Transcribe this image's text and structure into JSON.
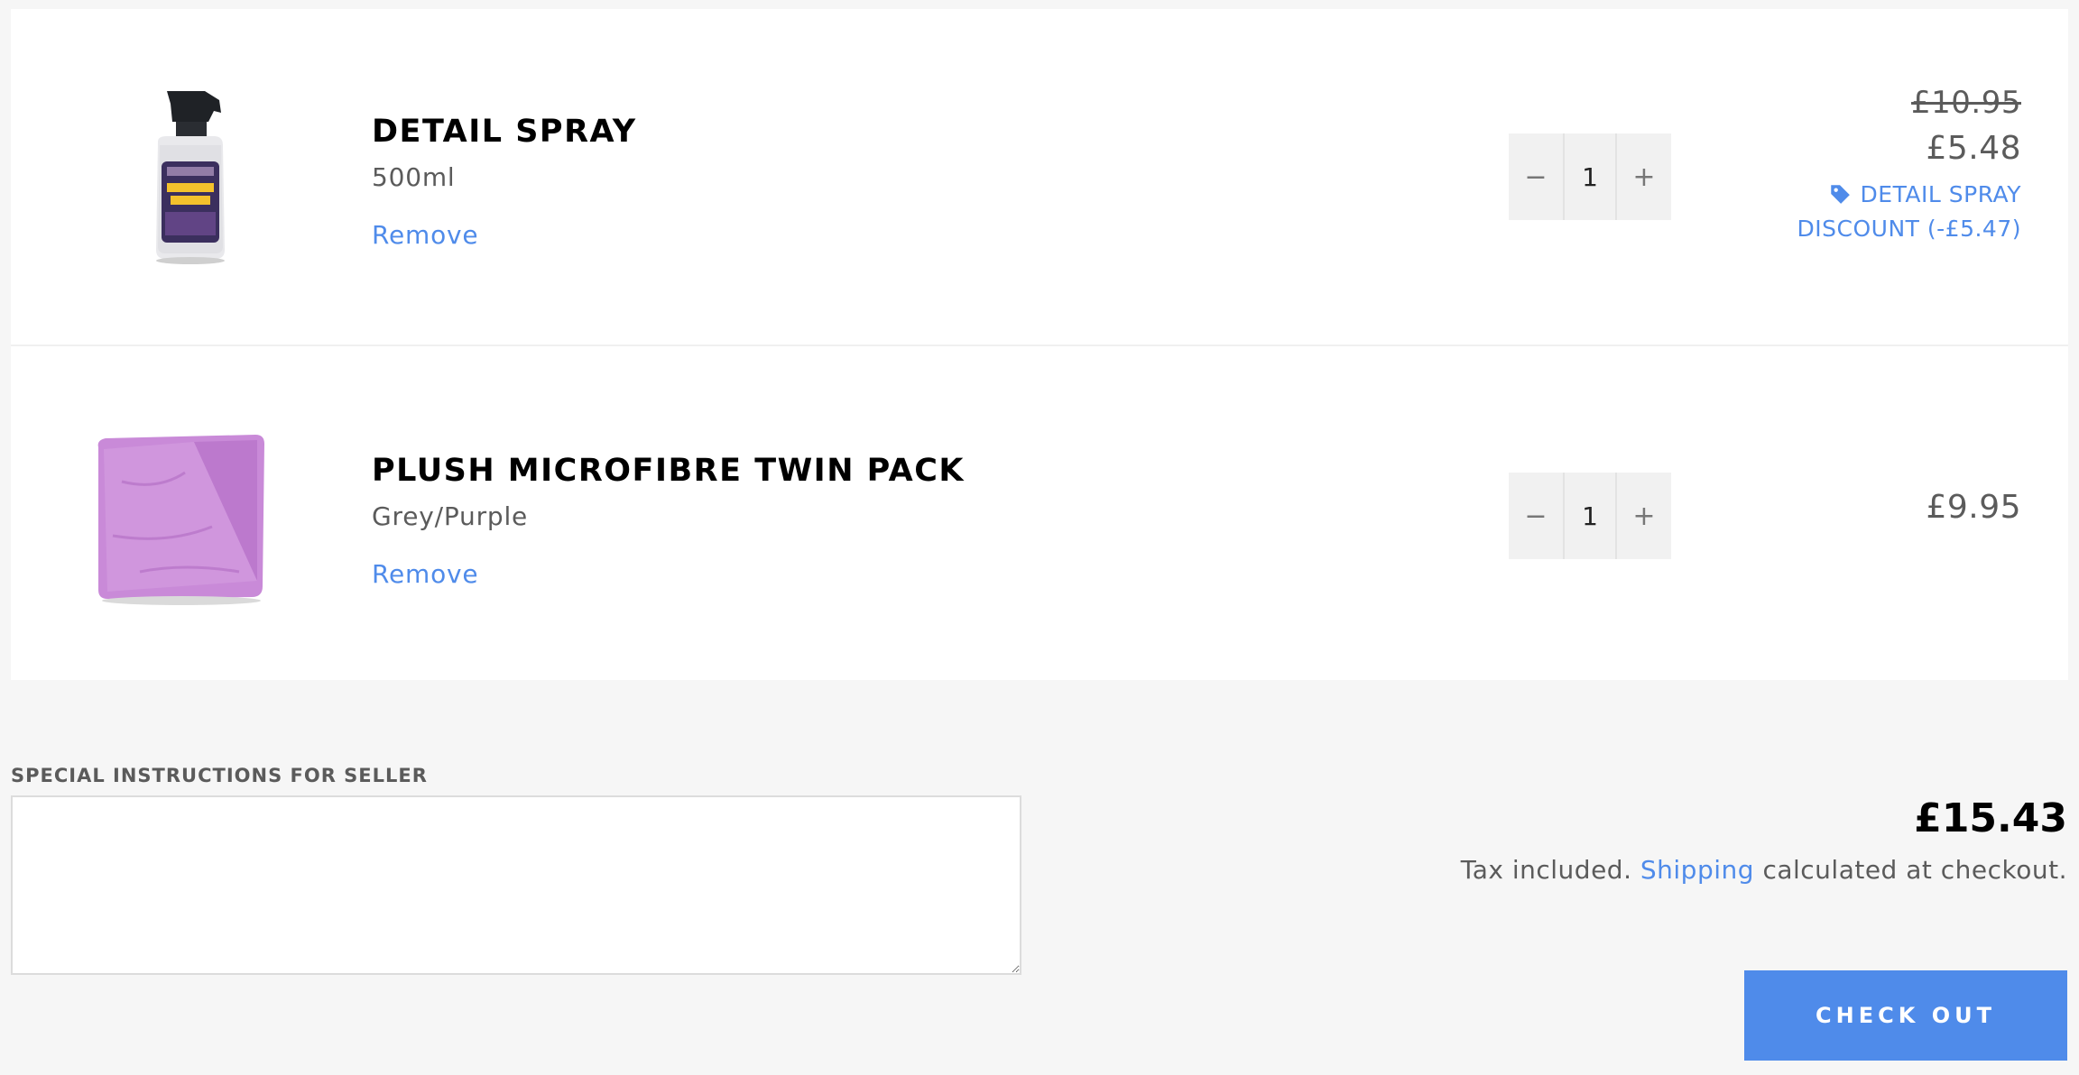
{
  "cart": {
    "items": [
      {
        "title": "DETAIL SPRAY",
        "variant": "500ml",
        "remove_label": "Remove",
        "quantity": "1",
        "original_price": "£10.95",
        "final_price": "£5.48",
        "discount_label": "DETAIL SPRAY",
        "discount_amount": "DISCOUNT (-£5.47)",
        "image_icon": "spray-bottle-image"
      },
      {
        "title": "PLUSH MICROFIBRE TWIN PACK",
        "variant": "Grey/Purple",
        "remove_label": "Remove",
        "quantity": "1",
        "final_price": "£9.95",
        "image_icon": "microfibre-towel-image"
      }
    ],
    "qty_minus": "−",
    "qty_plus": "+"
  },
  "instructions": {
    "label": "SPECIAL INSTRUCTIONS FOR SELLER",
    "value": ""
  },
  "summary": {
    "subtotal": "£15.43",
    "tax_prefix": "Tax included.",
    "shipping_link": "Shipping",
    "tax_suffix": "calculated at checkout.",
    "checkout_label": "CHECK OUT"
  },
  "colors": {
    "accent": "#4f8bea",
    "page_background": "#f6f6f6",
    "panel_background": "#ffffff",
    "text": "#5b5b5b",
    "title": "#000000"
  }
}
